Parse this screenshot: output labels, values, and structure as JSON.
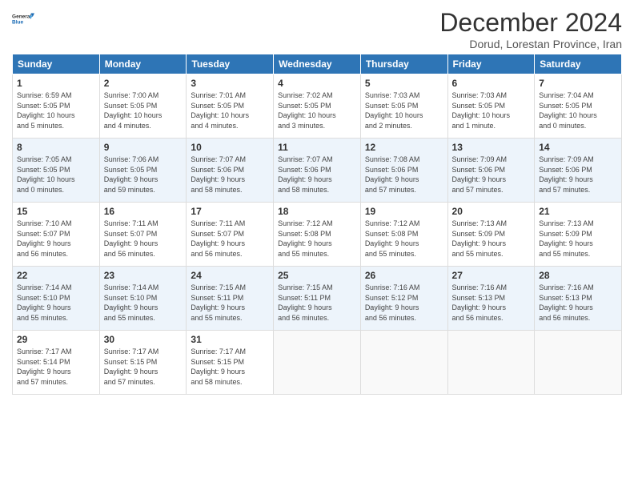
{
  "header": {
    "logo_line1": "General",
    "logo_line2": "Blue",
    "month_title": "December 2024",
    "subtitle": "Dorud, Lorestan Province, Iran"
  },
  "days_of_week": [
    "Sunday",
    "Monday",
    "Tuesday",
    "Wednesday",
    "Thursday",
    "Friday",
    "Saturday"
  ],
  "weeks": [
    [
      {
        "day": 1,
        "info": "Sunrise: 6:59 AM\nSunset: 5:05 PM\nDaylight: 10 hours\nand 5 minutes."
      },
      {
        "day": 2,
        "info": "Sunrise: 7:00 AM\nSunset: 5:05 PM\nDaylight: 10 hours\nand 4 minutes."
      },
      {
        "day": 3,
        "info": "Sunrise: 7:01 AM\nSunset: 5:05 PM\nDaylight: 10 hours\nand 4 minutes."
      },
      {
        "day": 4,
        "info": "Sunrise: 7:02 AM\nSunset: 5:05 PM\nDaylight: 10 hours\nand 3 minutes."
      },
      {
        "day": 5,
        "info": "Sunrise: 7:03 AM\nSunset: 5:05 PM\nDaylight: 10 hours\nand 2 minutes."
      },
      {
        "day": 6,
        "info": "Sunrise: 7:03 AM\nSunset: 5:05 PM\nDaylight: 10 hours\nand 1 minute."
      },
      {
        "day": 7,
        "info": "Sunrise: 7:04 AM\nSunset: 5:05 PM\nDaylight: 10 hours\nand 0 minutes."
      }
    ],
    [
      {
        "day": 8,
        "info": "Sunrise: 7:05 AM\nSunset: 5:05 PM\nDaylight: 10 hours\nand 0 minutes."
      },
      {
        "day": 9,
        "info": "Sunrise: 7:06 AM\nSunset: 5:05 PM\nDaylight: 9 hours\nand 59 minutes."
      },
      {
        "day": 10,
        "info": "Sunrise: 7:07 AM\nSunset: 5:06 PM\nDaylight: 9 hours\nand 58 minutes."
      },
      {
        "day": 11,
        "info": "Sunrise: 7:07 AM\nSunset: 5:06 PM\nDaylight: 9 hours\nand 58 minutes."
      },
      {
        "day": 12,
        "info": "Sunrise: 7:08 AM\nSunset: 5:06 PM\nDaylight: 9 hours\nand 57 minutes."
      },
      {
        "day": 13,
        "info": "Sunrise: 7:09 AM\nSunset: 5:06 PM\nDaylight: 9 hours\nand 57 minutes."
      },
      {
        "day": 14,
        "info": "Sunrise: 7:09 AM\nSunset: 5:06 PM\nDaylight: 9 hours\nand 57 minutes."
      }
    ],
    [
      {
        "day": 15,
        "info": "Sunrise: 7:10 AM\nSunset: 5:07 PM\nDaylight: 9 hours\nand 56 minutes."
      },
      {
        "day": 16,
        "info": "Sunrise: 7:11 AM\nSunset: 5:07 PM\nDaylight: 9 hours\nand 56 minutes."
      },
      {
        "day": 17,
        "info": "Sunrise: 7:11 AM\nSunset: 5:07 PM\nDaylight: 9 hours\nand 56 minutes."
      },
      {
        "day": 18,
        "info": "Sunrise: 7:12 AM\nSunset: 5:08 PM\nDaylight: 9 hours\nand 55 minutes."
      },
      {
        "day": 19,
        "info": "Sunrise: 7:12 AM\nSunset: 5:08 PM\nDaylight: 9 hours\nand 55 minutes."
      },
      {
        "day": 20,
        "info": "Sunrise: 7:13 AM\nSunset: 5:09 PM\nDaylight: 9 hours\nand 55 minutes."
      },
      {
        "day": 21,
        "info": "Sunrise: 7:13 AM\nSunset: 5:09 PM\nDaylight: 9 hours\nand 55 minutes."
      }
    ],
    [
      {
        "day": 22,
        "info": "Sunrise: 7:14 AM\nSunset: 5:10 PM\nDaylight: 9 hours\nand 55 minutes."
      },
      {
        "day": 23,
        "info": "Sunrise: 7:14 AM\nSunset: 5:10 PM\nDaylight: 9 hours\nand 55 minutes."
      },
      {
        "day": 24,
        "info": "Sunrise: 7:15 AM\nSunset: 5:11 PM\nDaylight: 9 hours\nand 55 minutes."
      },
      {
        "day": 25,
        "info": "Sunrise: 7:15 AM\nSunset: 5:11 PM\nDaylight: 9 hours\nand 56 minutes."
      },
      {
        "day": 26,
        "info": "Sunrise: 7:16 AM\nSunset: 5:12 PM\nDaylight: 9 hours\nand 56 minutes."
      },
      {
        "day": 27,
        "info": "Sunrise: 7:16 AM\nSunset: 5:13 PM\nDaylight: 9 hours\nand 56 minutes."
      },
      {
        "day": 28,
        "info": "Sunrise: 7:16 AM\nSunset: 5:13 PM\nDaylight: 9 hours\nand 56 minutes."
      }
    ],
    [
      {
        "day": 29,
        "info": "Sunrise: 7:17 AM\nSunset: 5:14 PM\nDaylight: 9 hours\nand 57 minutes."
      },
      {
        "day": 30,
        "info": "Sunrise: 7:17 AM\nSunset: 5:15 PM\nDaylight: 9 hours\nand 57 minutes."
      },
      {
        "day": 31,
        "info": "Sunrise: 7:17 AM\nSunset: 5:15 PM\nDaylight: 9 hours\nand 58 minutes."
      },
      {
        "day": null,
        "info": ""
      },
      {
        "day": null,
        "info": ""
      },
      {
        "day": null,
        "info": ""
      },
      {
        "day": null,
        "info": ""
      }
    ]
  ]
}
